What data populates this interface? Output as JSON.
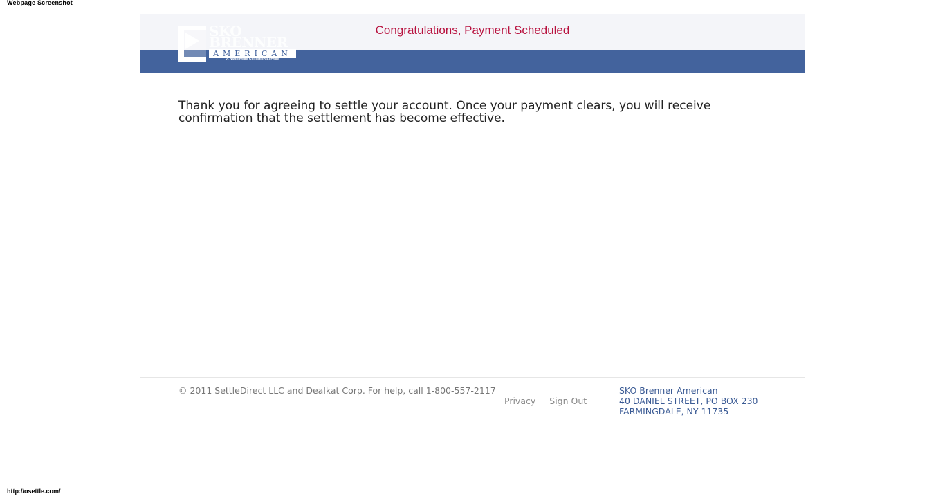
{
  "capture": {
    "title": "Webpage Screenshot",
    "url": "http://osettle.com/"
  },
  "header": {
    "title": "Congratulations, Payment Scheduled",
    "title_color": "#b8123f",
    "band_color": "#43639d",
    "logo": {
      "line1": "SKO",
      "line2": "BRENNER",
      "line3": "AMERICAN",
      "tagline": "A Nationwide Collection Service"
    }
  },
  "main": {
    "message": "Thank you for agreeing to settle your account. Once your payment clears, you will receive confirmation that the settlement has become effective."
  },
  "footer": {
    "copyright": "© 2011 SettleDirect LLC and Dealkat Corp. For help, call 1-800-557-2117",
    "links": {
      "privacy": "Privacy",
      "sign_out": "Sign Out"
    },
    "address": {
      "company": "SKO Brenner American",
      "street": "40 DANIEL STREET, PO BOX 230",
      "city": "FARMINGDALE, NY 11735"
    }
  }
}
